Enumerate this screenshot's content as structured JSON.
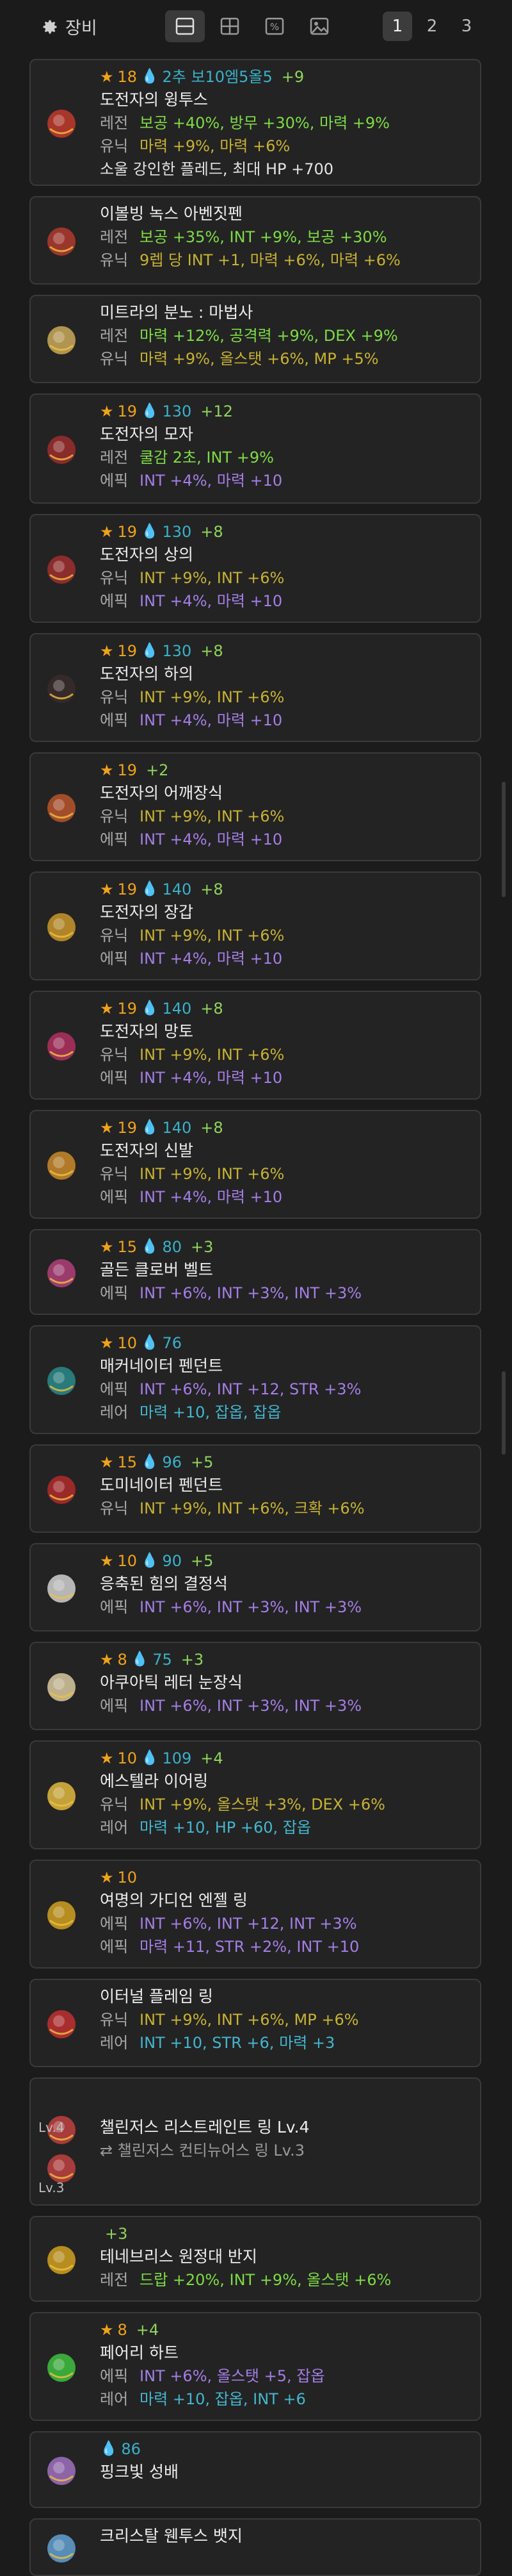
{
  "toolbar": {
    "title": "장비",
    "view_icons": [
      "split-view-icon",
      "grid-view-icon",
      "percent-icon",
      "image-icon"
    ],
    "pages": [
      "1",
      "2",
      "3"
    ],
    "active_page": "1"
  },
  "items": [
    {
      "star": "18",
      "drop": "2추 보10엠5올5",
      "plus": "+9",
      "name": "도전자의 윙투스",
      "lines": [
        {
          "label": "레전",
          "text": "보공 +40%, 방무 +30%, 마력 +9%",
          "cls": "legendary"
        },
        {
          "label": "유닉",
          "text": "마력 +9%, 마력 +6%",
          "cls": "unique"
        },
        {
          "label": "",
          "text": "소울 강인한 플레드, 최대 HP +700",
          "cls": "soul"
        }
      ],
      "icon": "weapon-icon",
      "color": "#c0392b"
    },
    {
      "name": "이볼빙 녹스 아벤짓펜",
      "lines": [
        {
          "label": "레전",
          "text": "보공 +35%, INT +9%, 보공 +30%",
          "cls": "legendary"
        },
        {
          "label": "유닉",
          "text": "9렙 당 INT +1, 마력 +6%, 마력 +6%",
          "cls": "unique"
        }
      ],
      "icon": "secondary-weapon-icon",
      "color": "#b03a2e"
    },
    {
      "name": "미트라의 분노 : 마법사",
      "lines": [
        {
          "label": "레전",
          "text": "마력 +12%, 공격력 +9%, DEX +9%",
          "cls": "legendary"
        },
        {
          "label": "유닉",
          "text": "마력 +9%, 올스탯 +6%, MP +5%",
          "cls": "unique"
        }
      ],
      "icon": "emblem-icon",
      "color": "#c9a85a"
    },
    {
      "star": "19",
      "drop": "130",
      "plus": "+12",
      "name": "도전자의 모자",
      "lines": [
        {
          "label": "레전",
          "text": "쿨감 2초, INT +9%",
          "cls": "legendary"
        },
        {
          "label": "에픽",
          "text": "INT +4%, 마력 +10",
          "cls": "epic"
        }
      ],
      "icon": "hat-icon",
      "color": "#9b2d2d"
    },
    {
      "star": "19",
      "drop": "130",
      "plus": "+8",
      "name": "도전자의 상의",
      "lines": [
        {
          "label": "유닉",
          "text": "INT +9%, INT +6%",
          "cls": "unique"
        },
        {
          "label": "에픽",
          "text": "INT +4%, 마력 +10",
          "cls": "epic"
        }
      ],
      "icon": "top-icon",
      "color": "#a02e2e"
    },
    {
      "star": "19",
      "drop": "130",
      "plus": "+8",
      "name": "도전자의 하의",
      "lines": [
        {
          "label": "유닉",
          "text": "INT +9%, INT +6%",
          "cls": "unique"
        },
        {
          "label": "에픽",
          "text": "INT +4%, 마력 +10",
          "cls": "epic"
        }
      ],
      "icon": "bottom-icon",
      "color": "#3a2a2a"
    },
    {
      "star": "19",
      "drop": "",
      "plus": "+2",
      "name": "도전자의 어깨장식",
      "lines": [
        {
          "label": "유닉",
          "text": "INT +9%, INT +6%",
          "cls": "unique"
        },
        {
          "label": "에픽",
          "text": "INT +4%, 마력 +10",
          "cls": "epic"
        }
      ],
      "icon": "shoulder-icon",
      "color": "#b8552a"
    },
    {
      "star": "19",
      "drop": "140",
      "plus": "+8",
      "name": "도전자의 장갑",
      "lines": [
        {
          "label": "유닉",
          "text": "INT +9%, INT +6%",
          "cls": "unique"
        },
        {
          "label": "에픽",
          "text": "INT +4%, 마력 +10",
          "cls": "epic"
        }
      ],
      "icon": "glove-icon",
      "color": "#c9952a"
    },
    {
      "star": "19",
      "drop": "140",
      "plus": "+8",
      "name": "도전자의 망토",
      "lines": [
        {
          "label": "유닉",
          "text": "INT +9%, INT +6%",
          "cls": "unique"
        },
        {
          "label": "에픽",
          "text": "INT +4%, 마력 +10",
          "cls": "epic"
        }
      ],
      "icon": "cape-icon",
      "color": "#b03060"
    },
    {
      "star": "19",
      "drop": "140",
      "plus": "+8",
      "name": "도전자의 신발",
      "lines": [
        {
          "label": "유닉",
          "text": "INT +9%, INT +6%",
          "cls": "unique"
        },
        {
          "label": "에픽",
          "text": "INT +4%, 마력 +10",
          "cls": "epic"
        }
      ],
      "icon": "shoe-icon",
      "color": "#c98a2a"
    },
    {
      "star": "15",
      "drop": "80",
      "plus": "+3",
      "name": "골든 클로버 벨트",
      "lines": [
        {
          "label": "에픽",
          "text": "INT +6%, INT +3%, INT +3%",
          "cls": "epic"
        }
      ],
      "icon": "belt-icon",
      "color": "#b0407a"
    },
    {
      "star": "10",
      "drop": "76",
      "plus": "",
      "name": "매커네이터 펜던트",
      "lines": [
        {
          "label": "에픽",
          "text": "INT +6%, INT +12, STR +3%",
          "cls": "epic"
        },
        {
          "label": "레어",
          "text": "마력 +10, 잡옵, 잡옵",
          "cls": "rare",
          "greyTail": true
        }
      ],
      "icon": "pendant-icon",
      "color": "#2a8a8a"
    },
    {
      "star": "15",
      "drop": "96",
      "plus": "+5",
      "name": "도미네이터 펜던트",
      "lines": [
        {
          "label": "유닉",
          "text": "INT +9%, INT +6%, 크확 +6%",
          "cls": "unique"
        }
      ],
      "icon": "pendant2-icon",
      "color": "#b02a2a"
    },
    {
      "star": "10",
      "drop": "90",
      "plus": "+5",
      "name": "응축된 힘의 결정석",
      "lines": [
        {
          "label": "에픽",
          "text": "INT +6%, INT +3%, INT +3%",
          "cls": "epic"
        }
      ],
      "icon": "pocket-icon",
      "color": "#d0d0d0"
    },
    {
      "star": "8",
      "drop": "75",
      "plus": "+3",
      "name": "아쿠아틱 레터 눈장식",
      "lines": [
        {
          "label": "에픽",
          "text": "INT +6%, INT +3%, INT +3%",
          "cls": "epic"
        }
      ],
      "icon": "eye-accessory-icon",
      "color": "#d8c9a0"
    },
    {
      "star": "10",
      "drop": "109",
      "plus": "+4",
      "name": "에스텔라 이어링",
      "lines": [
        {
          "label": "유닉",
          "text": "INT +9%, 올스탯 +3%, DEX +6%",
          "cls": "unique"
        },
        {
          "label": "레어",
          "text": "마력 +10, HP +60, 잡옵",
          "cls": "rare",
          "greyTail": true
        }
      ],
      "icon": "earring-icon",
      "color": "#e0b840"
    },
    {
      "star": "10",
      "drop": "",
      "plus": "",
      "name": "여명의 가디언 엔젤 링",
      "lines": [
        {
          "label": "에픽",
          "text": "INT +6%, INT +12, INT +3%",
          "cls": "epic"
        },
        {
          "label": "에픽",
          "text": "마력 +11, STR +2%, INT +10",
          "cls": "epic"
        }
      ],
      "icon": "ring-icon",
      "color": "#d0a020"
    },
    {
      "name": "이터널 플레임 링",
      "lines": [
        {
          "label": "유닉",
          "text": "INT +9%, INT +6%, MP +6%",
          "cls": "unique"
        },
        {
          "label": "레어",
          "text": "INT +10, STR +6, 마력 +3",
          "cls": "rare"
        }
      ],
      "icon": "ring2-icon",
      "color": "#c03030"
    },
    {
      "name": "챌린저스 리스트레인트 링 Lv.4",
      "sub": "⇄ 챌린저스 컨티뉴어스 링 Lv.3",
      "lv1": "Lv.4",
      "lv2": "Lv.3",
      "lines": [],
      "icon": "ring3-icon",
      "color": "#c04040"
    },
    {
      "plus": "+3",
      "name": "테네브리스 원정대 반지",
      "lines": [
        {
          "label": "레전",
          "text": "드랍 +20%, INT +9%, 올스탯 +6%",
          "cls": "legendary"
        }
      ],
      "icon": "ring4-icon",
      "color": "#d0a020"
    },
    {
      "star": "8",
      "drop": "",
      "plus": "+4",
      "name": "페어리 하트",
      "lines": [
        {
          "label": "에픽",
          "text": "INT +6%, 올스탯 +5, 잡옵",
          "cls": "epic",
          "greyTail": true
        },
        {
          "label": "레어",
          "text": "마력 +10, 잡옵, INT +6",
          "cls": "rare",
          "greyTail": true
        }
      ],
      "icon": "heart-icon",
      "color": "#40c040"
    },
    {
      "drop": "86",
      "name": "핑크빛 성배",
      "lines": [],
      "icon": "chalice-icon",
      "color": "#a070c0"
    },
    {
      "name": "크리스탈 웬투스 뱃지",
      "lines": [],
      "icon": "badge-icon",
      "color": "#60a0d0"
    }
  ]
}
